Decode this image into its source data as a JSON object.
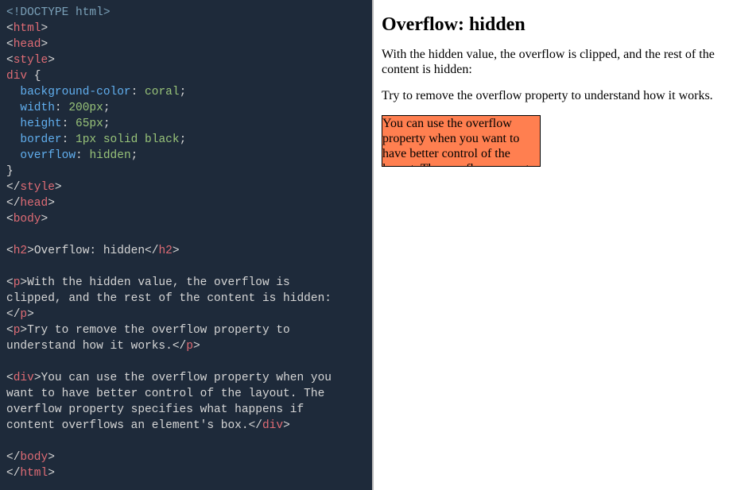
{
  "code": {
    "doctype": "<!DOCTYPE html>",
    "html_open": "html",
    "head_open": "head",
    "style_open": "style",
    "selector": "div",
    "rules": {
      "bg": {
        "prop": "background-color",
        "val": "coral"
      },
      "w": {
        "prop": "width",
        "val": "200px"
      },
      "h": {
        "prop": "height",
        "val": "65px"
      },
      "border": {
        "prop": "border",
        "val": "1px solid black"
      },
      "overflow": {
        "prop": "overflow",
        "val": "hidden"
      }
    },
    "style_close": "style",
    "head_close": "head",
    "body_open": "body",
    "h2_tag": "h2",
    "h2_text": "Overflow: hidden",
    "p_tag": "p",
    "p1_text": "With the hidden value, the overflow is\nclipped, and the rest of the content is hidden:",
    "p2_text": "Try to remove the overflow property to\nunderstand how it works.",
    "div_tag": "div",
    "div_text": "You can use the overflow property when you\nwant to have better control of the layout. The\noverflow property specifies what happens if\ncontent overflows an element's box.",
    "body_close": "body",
    "html_close": "html"
  },
  "preview": {
    "heading": "Overflow: hidden",
    "para1": "With the hidden value, the overflow is clipped, and the rest of the content is hidden:",
    "para2": "Try to remove the overflow property to understand how it works.",
    "box_text": "You can use the overflow property when you want to have better control of the layout. The overflow property specifies what happens if content overflows an element's box."
  }
}
